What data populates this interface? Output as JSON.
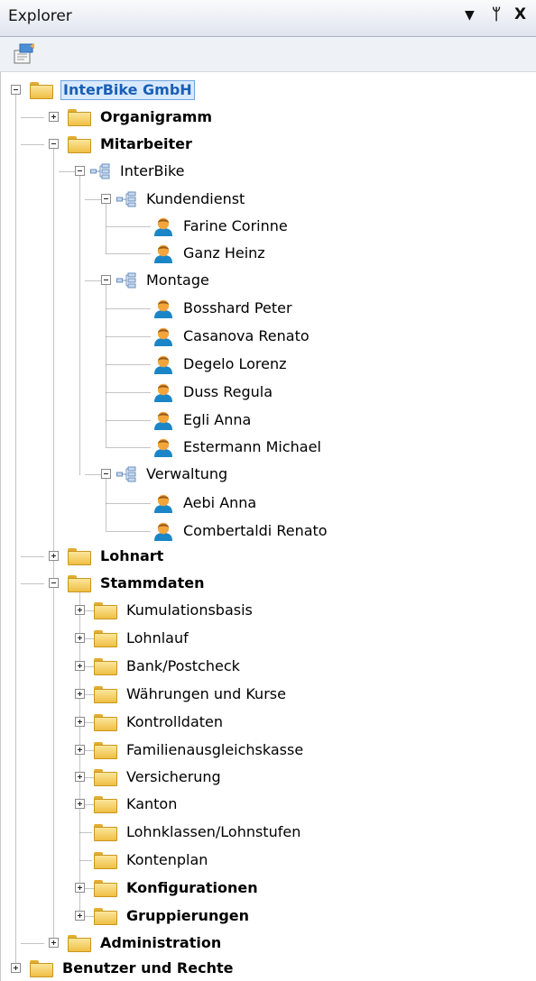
{
  "panel": {
    "title": "Explorer",
    "controls": {
      "dropdown": "▼",
      "pin": "ᛘ",
      "close": "X"
    }
  },
  "tree": {
    "root": "InterBike GmbH",
    "organigramm": "Organigramm",
    "mitarbeiter": "Mitarbeiter",
    "interbike": "InterBike",
    "kundendienst": "Kundendienst",
    "farine": "Farine Corinne",
    "ganz": "Ganz Heinz",
    "montage": "Montage",
    "bosshard": "Bosshard Peter",
    "casanova": "Casanova Renato",
    "degelo": "Degelo Lorenz",
    "duss": "Duss Regula",
    "egli": "Egli Anna",
    "estermann": "Estermann Michael",
    "verwaltung": "Verwaltung",
    "aebi": "Aebi Anna",
    "combertaldi": "Combertaldi Renato",
    "lohnart": "Lohnart",
    "stammdaten": "Stammdaten",
    "kumulationsbasis": "Kumulationsbasis",
    "lohnlauf": "Lohnlauf",
    "bank": "Bank/Postcheck",
    "waehrungen": "Währungen und Kurse",
    "kontrolldaten": "Kontrolldaten",
    "familien": "Familienausgleichskasse",
    "versicherung": "Versicherung",
    "kanton": "Kanton",
    "lohnklassen": "Lohnklassen/Lohnstufen",
    "kontenplan": "Kontenplan",
    "konfigurationen": "Konfigurationen",
    "gruppierungen": "Gruppierungen",
    "administration": "Administration",
    "benutzer": "Benutzer und Rechte"
  },
  "colors": {
    "selection": "#d8e9ff",
    "folder": "#efbf45",
    "person_head": "#f3a53c",
    "person_body": "#1b86c7"
  }
}
